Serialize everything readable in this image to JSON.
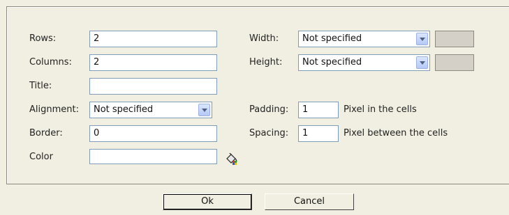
{
  "form": {
    "rows": {
      "label": "Rows:",
      "value": "2"
    },
    "columns": {
      "label": "Columns:",
      "value": "2"
    },
    "title": {
      "label": "Title:",
      "value": ""
    },
    "alignment": {
      "label": "Alignment:",
      "selected": "Not specified"
    },
    "border": {
      "label": "Border:",
      "value": "0"
    },
    "color": {
      "label": "Color",
      "value": ""
    },
    "width": {
      "label": "Width:",
      "selected": "Not specified"
    },
    "height": {
      "label": "Height:",
      "selected": "Not specified"
    },
    "padding": {
      "label": "Padding:",
      "value": "1",
      "suffix": "Pixel in the cells"
    },
    "spacing": {
      "label": "Spacing:",
      "value": "1",
      "suffix": "Pixel between the cells"
    }
  },
  "buttons": {
    "ok": "Ok",
    "cancel": "Cancel"
  },
  "icons": {
    "color_picker": "paint-bucket-icon"
  }
}
